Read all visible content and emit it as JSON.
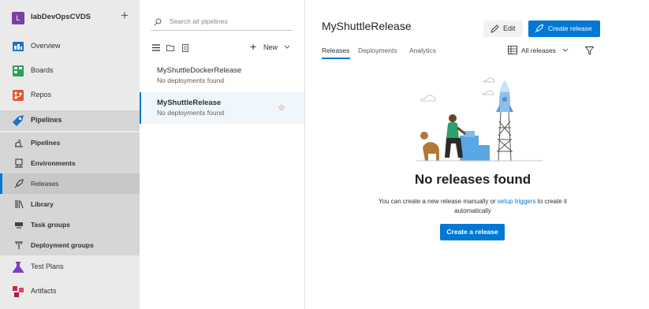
{
  "org": {
    "badge": "L",
    "name": "labDevOpsCVDS",
    "add_symbol": "+"
  },
  "nav": {
    "overview": "Overview",
    "boards": "Boards",
    "repos": "Repos",
    "pipelines": "Pipelines",
    "sub": {
      "pipelines": "Pipelines",
      "environments": "Environments",
      "releases": "Releases",
      "library": "Library",
      "task_groups": "Task groups",
      "deployment_groups": "Deployment groups"
    },
    "test_plans": "Test Plans",
    "artifacts": "Artifacts"
  },
  "list": {
    "search_placeholder": "Search all pipelines",
    "new_label": "New",
    "items": [
      {
        "title": "MyShuttleDockerRelease",
        "status": "No deployments found"
      },
      {
        "title": "MyShuttleRelease",
        "status": "No deployments found"
      }
    ]
  },
  "main": {
    "title": "MyShuttleRelease",
    "edit_label": "Edit",
    "create_release_label": "Create release",
    "tabs": [
      "Releases",
      "Deployments",
      "Analytics"
    ],
    "filter_label": "All releases",
    "empty": {
      "title": "No releases found",
      "desc_before": "You can create a new release manually or ",
      "desc_link": "setup triggers",
      "desc_after": " to create it automatically",
      "button": "Create a release"
    }
  },
  "colors": {
    "accent": "#0078d4",
    "nav_bg": "#eaeaea"
  }
}
